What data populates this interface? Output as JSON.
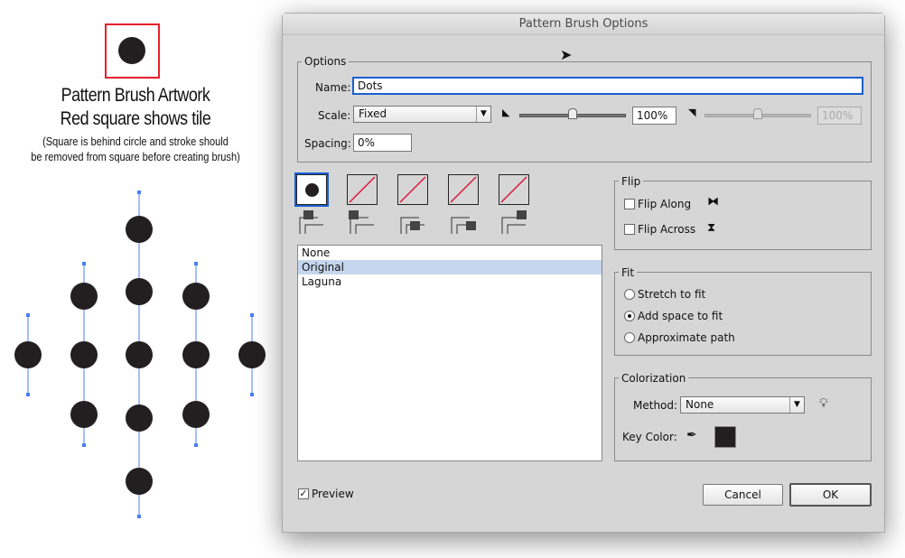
{
  "artwork": {
    "title1": "Pattern Brush Artwork",
    "title2": "Red square shows tile",
    "note1": "(Square is behind circle and stroke should",
    "note2": "be removed from square before creating brush)",
    "tile_color": "#e8202a",
    "dot_color": "#231f20",
    "path_color": "#4a7ff0"
  },
  "dialog": {
    "title": "Pattern Brush Options",
    "options": {
      "legend": "Options",
      "name_label": "Name:",
      "name_value": "Dots",
      "scale_label": "Scale:",
      "scale_value": "Fixed",
      "scale_pct": "100%",
      "scale_pct2": "100%",
      "slider1_pct": 50,
      "slider2_pct": 50,
      "spacing_label": "Spacing:",
      "spacing_value": "0%"
    },
    "tiles": [
      "side-tile",
      "outer-corner-tile",
      "inner-corner-tile",
      "start-tile",
      "end-tile"
    ],
    "pattern_list": {
      "items": [
        "None",
        "Original",
        "Laguna"
      ],
      "selected": "Original"
    },
    "flip": {
      "legend": "Flip",
      "along": "Flip Along",
      "across": "Flip Across",
      "along_checked": false,
      "across_checked": false
    },
    "fit": {
      "legend": "Fit",
      "options": [
        "Stretch to fit",
        "Add space to fit",
        "Approximate path"
      ],
      "selected": "Add space to fit"
    },
    "colorization": {
      "legend": "Colorization",
      "method_label": "Method:",
      "method_value": "None",
      "key_color_label": "Key Color:",
      "key_color": "#231f20"
    },
    "preview_label": "Preview",
    "preview_checked": true,
    "cancel": "Cancel",
    "ok": "OK",
    "accent": "#1a5fd0",
    "selection": "#c5d6ee"
  }
}
